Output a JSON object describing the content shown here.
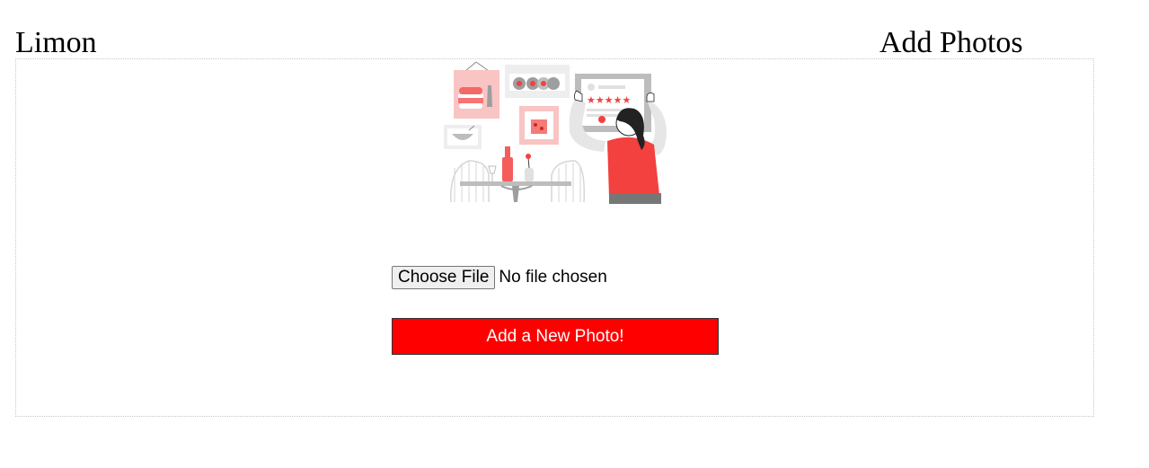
{
  "header": {
    "brand": "Limon",
    "page_title": "Add Photos"
  },
  "upload": {
    "choose_file_label": "Choose File",
    "file_status": "No file chosen",
    "submit_label": "Add a New Photo!"
  },
  "illustration": {
    "icon": "restaurant-review-illustration",
    "rating_stars": 5
  },
  "colors": {
    "accent": "#ff0000",
    "illustration_red": "#f2413f",
    "illustration_pink": "#f9c4c4",
    "panel_border": "#c8c8c8"
  }
}
